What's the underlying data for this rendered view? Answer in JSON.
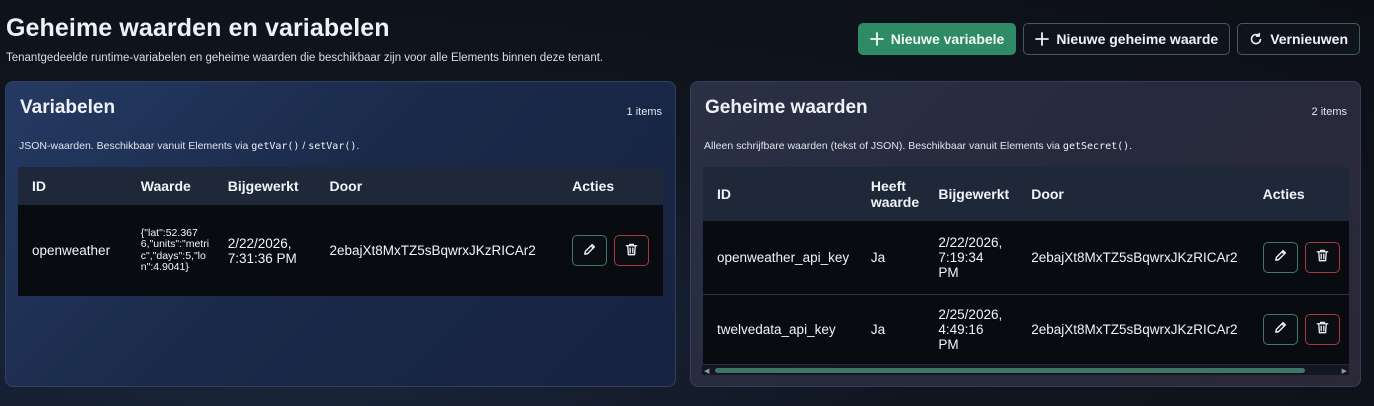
{
  "header": {
    "title": "Geheime waarden en variabelen",
    "subtitle": "Tenantgedeelde runtime-variabelen en geheime waarden die beschikbaar zijn voor alle Elements binnen deze tenant."
  },
  "toolbar": {
    "new_variable": "Nieuwe variabele",
    "new_secret": "Nieuwe geheime waarde",
    "refresh": "Vernieuwen"
  },
  "variables": {
    "title": "Variabelen",
    "count": "1 items",
    "desc_prefix": "JSON-waarden. Beschikbaar vanuit Elements via ",
    "desc_code1": "getVar()",
    "desc_sep": " / ",
    "desc_code2": "setVar()",
    "desc_suffix": ".",
    "columns": {
      "id": "ID",
      "value": "Waarde",
      "updated": "Bijgewerkt",
      "by": "Door",
      "actions": "Acties"
    },
    "rows": [
      {
        "id": "openweather",
        "value": "{\"lat\":52.3676,\"units\":\"metric\",\"days\":5,\"lon\":4.9041}",
        "updated": "2/22/2026, 7:31:36 PM",
        "by": "2ebajXt8MxTZ5sBqwrxJKzRICAr2"
      }
    ]
  },
  "secrets": {
    "title": "Geheime waarden",
    "count": "2 items",
    "desc_prefix": "Alleen schrijfbare waarden (tekst of JSON). Beschikbaar vanuit Elements via ",
    "desc_code1": "getSecret()",
    "desc_suffix": ".",
    "columns": {
      "id": "ID",
      "has_value": "Heeft waarde",
      "updated": "Bijgewerkt",
      "by": "Door",
      "actions": "Acties"
    },
    "rows": [
      {
        "id": "openweather_api_key",
        "has_value": "Ja",
        "updated": "2/22/2026, 7:19:34 PM",
        "by": "2ebajXt8MxTZ5sBqwrxJKzRICAr2"
      },
      {
        "id": "twelvedata_api_key",
        "has_value": "Ja",
        "updated": "2/25/2026, 4:49:16 PM",
        "by": "2ebajXt8MxTZ5sBqwrxJKzRICAr2"
      }
    ]
  },
  "icons": {
    "add": "plus-icon",
    "refresh": "refresh-icon",
    "edit": "pencil-icon",
    "delete": "trash-icon"
  },
  "colors": {
    "primary": "#2f8a66",
    "danger": "#a83a3a"
  }
}
